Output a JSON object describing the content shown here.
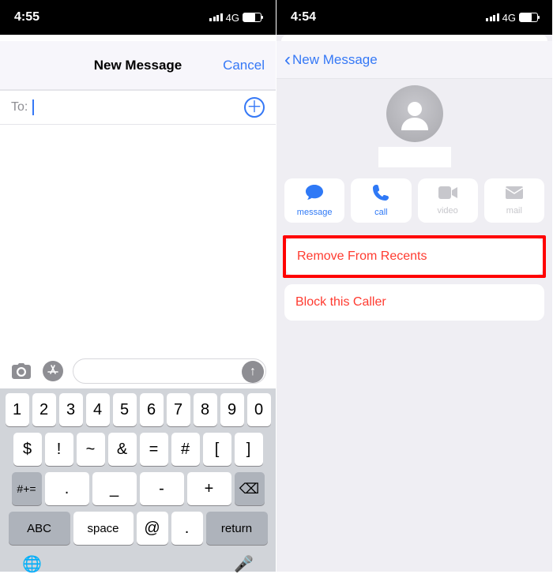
{
  "left": {
    "status": {
      "time": "4:55",
      "net": "4G"
    },
    "nav": {
      "title": "New Message",
      "cancel": "Cancel"
    },
    "to": {
      "label": "To:"
    },
    "keyboard": {
      "row1": [
        "1",
        "2",
        "3",
        "4",
        "5",
        "6",
        "7",
        "8",
        "9",
        "0"
      ],
      "row2": [
        "$",
        "!",
        "~",
        "&",
        "=",
        "#",
        "[",
        "]"
      ],
      "numswitch": "#+=",
      "r3": [
        ".",
        "_",
        "-",
        "+"
      ],
      "del": "⌫",
      "abc": "ABC",
      "space": "space",
      "at": "@",
      "dot": ".",
      "ret": "return"
    }
  },
  "right": {
    "status": {
      "time": "4:54",
      "net": "4G"
    },
    "back": "New Message",
    "actions": {
      "message": "message",
      "call": "call",
      "video": "video",
      "mail": "mail"
    },
    "remove": "Remove From Recents",
    "block": "Block this Caller"
  }
}
